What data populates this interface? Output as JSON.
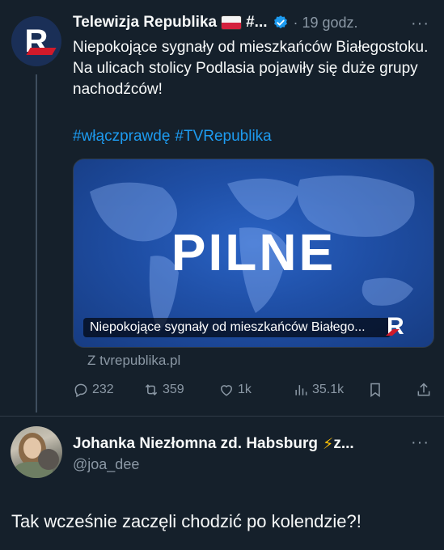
{
  "tweet": {
    "author_name": "Telewizja Republika",
    "name_ellipsis": "#...",
    "meta": "· 19 godz.",
    "more": "···",
    "text": "Niepokojące sygnały od mieszkańców Białegostoku. Na ulicach stolicy Podlasia pojawiły się duże grupy nachodźców!",
    "hashtags": [
      "#włączprawdę",
      "#TVRepublika"
    ],
    "media": {
      "headline": "PILNE",
      "caption": "Niepokojące sygnały od mieszkańców Białego..."
    },
    "source": "Z tvrepublika.pl",
    "actions": {
      "replies": "232",
      "retweets": "359",
      "likes": "1k",
      "views": "35.1k"
    }
  },
  "reply": {
    "author_name": "Johanka Niezłomna zd. Habsburg",
    "name_suffix": "z...",
    "handle": "@joa_dee",
    "more": "···",
    "text": "Tak wcześnie zaczęli chodzić po kolendzie?!"
  },
  "colors": {
    "background": "#15202b",
    "text": "#f7f9f9",
    "muted": "#8b98a5",
    "link": "#1d9bf0",
    "verified": "#1d9bf0"
  }
}
